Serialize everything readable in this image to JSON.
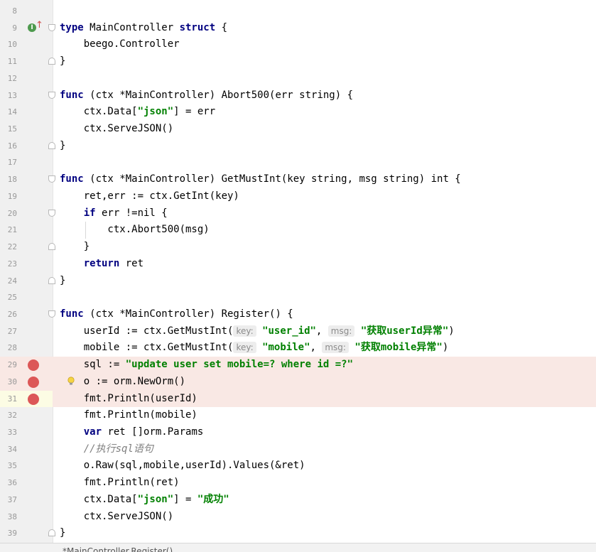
{
  "editor": {
    "lines": [
      {
        "n": "8",
        "tokens": []
      },
      {
        "n": "9",
        "gutter": "impl",
        "fold": "open",
        "tokens": [
          [
            "kw",
            "type"
          ],
          [
            "t",
            " MainController "
          ],
          [
            "kw",
            "struct"
          ],
          [
            "t",
            " {"
          ]
        ]
      },
      {
        "n": "10",
        "tokens": [
          [
            "t",
            "    beego.Controller"
          ]
        ]
      },
      {
        "n": "11",
        "fold": "close",
        "tokens": [
          [
            "t",
            "}"
          ]
        ]
      },
      {
        "n": "12",
        "tokens": []
      },
      {
        "n": "13",
        "fold": "open",
        "tokens": [
          [
            "kw",
            "func"
          ],
          [
            "t",
            " (ctx *MainController) Abort500(err string) {"
          ]
        ]
      },
      {
        "n": "14",
        "tokens": [
          [
            "t",
            "    ctx.Data["
          ],
          [
            "str",
            "\"json\""
          ],
          [
            "t",
            "] = err"
          ]
        ]
      },
      {
        "n": "15",
        "tokens": [
          [
            "t",
            "    ctx.ServeJSON()"
          ]
        ]
      },
      {
        "n": "16",
        "fold": "close",
        "tokens": [
          [
            "t",
            "}"
          ]
        ]
      },
      {
        "n": "17",
        "tokens": []
      },
      {
        "n": "18",
        "fold": "open",
        "tokens": [
          [
            "kw",
            "func"
          ],
          [
            "t",
            " (ctx *MainController) GetMustInt(key string, msg string) int {"
          ]
        ]
      },
      {
        "n": "19",
        "tokens": [
          [
            "t",
            "    ret,err := ctx.GetInt(key)"
          ]
        ]
      },
      {
        "n": "20",
        "fold": "open",
        "tokens": [
          [
            "t",
            "    "
          ],
          [
            "kw",
            "if"
          ],
          [
            "t",
            " err !=nil {"
          ]
        ]
      },
      {
        "n": "21",
        "guide": true,
        "tokens": [
          [
            "t",
            "        ctx.Abort500(msg)"
          ]
        ]
      },
      {
        "n": "22",
        "fold": "close",
        "tokens": [
          [
            "t",
            "    }"
          ]
        ]
      },
      {
        "n": "23",
        "tokens": [
          [
            "t",
            "    "
          ],
          [
            "kw",
            "return"
          ],
          [
            "t",
            " ret"
          ]
        ]
      },
      {
        "n": "24",
        "fold": "close",
        "tokens": [
          [
            "t",
            "}"
          ]
        ]
      },
      {
        "n": "25",
        "tokens": []
      },
      {
        "n": "26",
        "fold": "open",
        "tokens": [
          [
            "kw",
            "func"
          ],
          [
            "t",
            " (ctx *MainController) Register() {"
          ]
        ]
      },
      {
        "n": "27",
        "tokens": [
          [
            "t",
            "    userId := ctx.GetMustInt("
          ],
          [
            "hint",
            "key:"
          ],
          [
            "t",
            " "
          ],
          [
            "str",
            "\"user_id\""
          ],
          [
            "t",
            ", "
          ],
          [
            "hint",
            "msg:"
          ],
          [
            "t",
            " "
          ],
          [
            "str",
            "\"获取userId异常\""
          ],
          [
            "t",
            ")"
          ]
        ]
      },
      {
        "n": "28",
        "tokens": [
          [
            "t",
            "    mobile := ctx.GetMustInt("
          ],
          [
            "hint",
            "key:"
          ],
          [
            "t",
            " "
          ],
          [
            "str",
            "\"mobile\""
          ],
          [
            "t",
            ", "
          ],
          [
            "hint",
            "msg:"
          ],
          [
            "t",
            " "
          ],
          [
            "str",
            "\"获取mobile异常\""
          ],
          [
            "t",
            ")"
          ]
        ]
      },
      {
        "n": "29",
        "gutter": "bp",
        "hl": true,
        "tokens": [
          [
            "t",
            "    sql := "
          ],
          [
            "str",
            "\"update user set mobile=? where id =?\""
          ]
        ]
      },
      {
        "n": "30",
        "gutter": "bp",
        "hl": true,
        "bulb": true,
        "tokens": [
          [
            "t",
            "    o := orm.NewOrm()"
          ]
        ]
      },
      {
        "n": "31",
        "gutter": "bp",
        "hl": true,
        "cur": true,
        "tokens": [
          [
            "t",
            "    fmt.Println(userId)"
          ]
        ]
      },
      {
        "n": "32",
        "tokens": [
          [
            "t",
            "    fmt.Println(mobile)"
          ]
        ]
      },
      {
        "n": "33",
        "tokens": [
          [
            "t",
            "    "
          ],
          [
            "kw",
            "var"
          ],
          [
            "t",
            " ret []orm.Params"
          ]
        ]
      },
      {
        "n": "34",
        "tokens": [
          [
            "t",
            "    "
          ],
          [
            "cm",
            "//执行sql语句"
          ]
        ]
      },
      {
        "n": "35",
        "tokens": [
          [
            "t",
            "    o.Raw(sql,mobile,userId).Values(&ret)"
          ]
        ]
      },
      {
        "n": "36",
        "tokens": [
          [
            "t",
            "    fmt.Println(ret)"
          ]
        ]
      },
      {
        "n": "37",
        "tokens": [
          [
            "t",
            "    ctx.Data["
          ],
          [
            "str",
            "\"json\""
          ],
          [
            "t",
            "] = "
          ],
          [
            "str",
            "\"成功\""
          ]
        ]
      },
      {
        "n": "38",
        "tokens": [
          [
            "t",
            "    ctx.ServeJSON()"
          ]
        ]
      },
      {
        "n": "39",
        "fold": "close",
        "tokens": [
          [
            "t",
            "}"
          ]
        ]
      }
    ]
  },
  "statusbar": {
    "breadcrumb": "*MainController.Register()"
  },
  "colors": {
    "keyword": "#000080",
    "string": "#008000",
    "comment": "#808080",
    "breakpoint": "#dc5757",
    "breakpoint_line_bg": "#f9e8e4",
    "gutter_bg": "#f0f0f0"
  },
  "icons": {
    "implemented": "implemented-interface-icon",
    "breakpoint": "breakpoint-icon",
    "intention": "lightbulb-icon",
    "fold": "fold-marker-icon"
  }
}
